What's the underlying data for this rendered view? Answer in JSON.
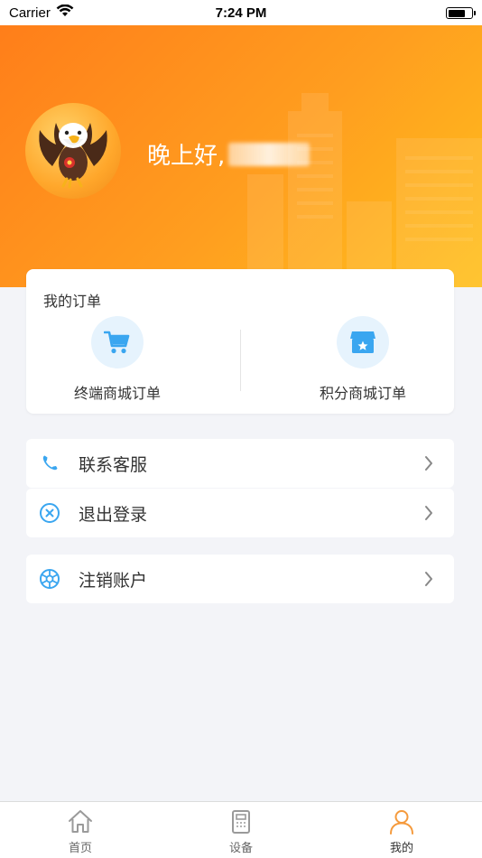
{
  "status_bar": {
    "carrier": "Carrier",
    "time": "7:24 PM"
  },
  "header": {
    "greeting": "晚上好,"
  },
  "orders": {
    "title": "我的订单",
    "items": [
      {
        "label": "终端商城订单",
        "icon": "shopping-cart-icon"
      },
      {
        "label": "积分商城订单",
        "icon": "store-icon"
      }
    ]
  },
  "menu": [
    {
      "label": "联系客服",
      "icon": "phone-icon"
    },
    {
      "label": "退出登录",
      "icon": "logout-icon"
    },
    {
      "label": "注销账户",
      "icon": "cancel-account-icon"
    }
  ],
  "tabs": [
    {
      "label": "首页",
      "icon": "home-icon",
      "active": false
    },
    {
      "label": "设备",
      "icon": "device-icon",
      "active": false
    },
    {
      "label": "我的",
      "icon": "profile-icon",
      "active": true
    }
  ],
  "colors": {
    "header_start": "#ff7e1a",
    "header_end": "#ffc01d",
    "accent_blue": "#3aa6f0",
    "active_tab": "#f59a3c"
  }
}
